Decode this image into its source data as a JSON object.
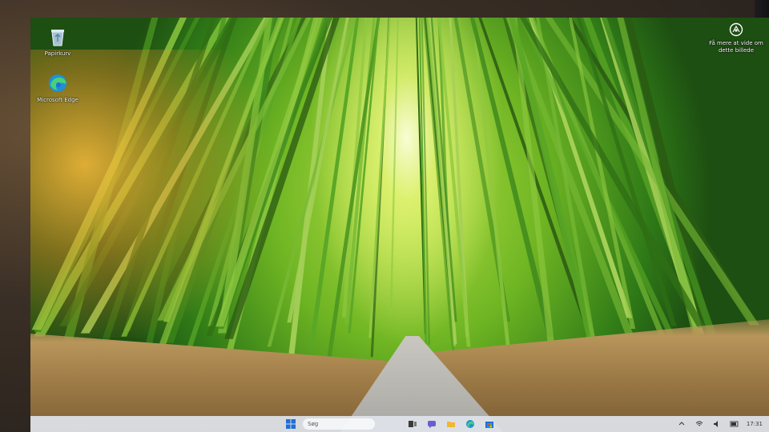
{
  "desktop": {
    "icons": [
      {
        "label": "Papirkurv",
        "icon": "recycle-bin-icon"
      },
      {
        "label": "Microsoft Edge",
        "icon": "edge-icon"
      }
    ],
    "spotlight": {
      "label": "Få mere at vide om dette billede",
      "icon": "camera-icon"
    }
  },
  "taskbar": {
    "search_placeholder": "Søg",
    "clock": "17:31",
    "apps": [
      "task-view-icon",
      "chat-icon",
      "file-explorer-icon",
      "edge-icon",
      "store-icon"
    ]
  },
  "colors": {
    "taskbar_bg": "#e0e4ec",
    "windows_blue": "#1f6fd6",
    "bamboo_green": "#4f9e22",
    "grass": "#b8955a"
  }
}
